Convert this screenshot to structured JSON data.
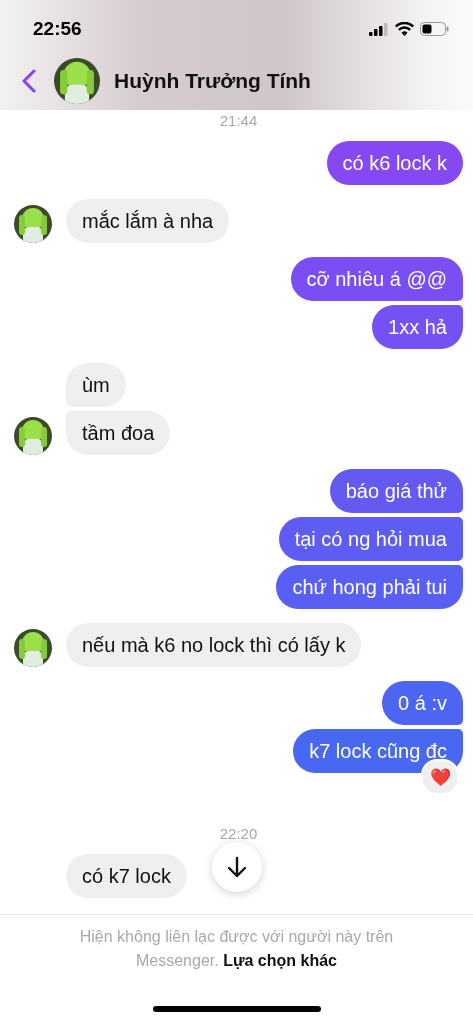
{
  "status_bar": {
    "time": "22:56"
  },
  "header": {
    "name": "Huỳnh Trưởng Tính"
  },
  "messages": [
    {
      "kind": "time",
      "text": "21:44"
    },
    {
      "kind": "out",
      "text": "có k6 lock k"
    },
    {
      "kind": "in",
      "text": "mắc lắm à nha",
      "avatar": true
    },
    {
      "kind": "out",
      "text": "cỡ nhiêu á @@"
    },
    {
      "kind": "out",
      "text": "1xx hả"
    },
    {
      "kind": "in",
      "text": "ùm",
      "avatar": false
    },
    {
      "kind": "in",
      "text": "tầm đoa",
      "avatar": true
    },
    {
      "kind": "out",
      "text": "báo giá thử"
    },
    {
      "kind": "out",
      "text": "tại có ng hỏi mua"
    },
    {
      "kind": "out",
      "text": "chứ hong phải tui"
    },
    {
      "kind": "in",
      "text": "nếu mà k6 no lock thì có lấy k",
      "avatar": true
    },
    {
      "kind": "out",
      "text": "0 á :v"
    },
    {
      "kind": "out",
      "text": "k7 lock cũng đc",
      "reaction": "❤️"
    },
    {
      "kind": "time",
      "text": "22:20"
    },
    {
      "kind": "in",
      "text": "có k7 lock",
      "avatar": false
    }
  ],
  "footer": {
    "notice": "Hiện không liên lạc được với người này trên Messenger.",
    "link": "Lựa chọn khác"
  }
}
